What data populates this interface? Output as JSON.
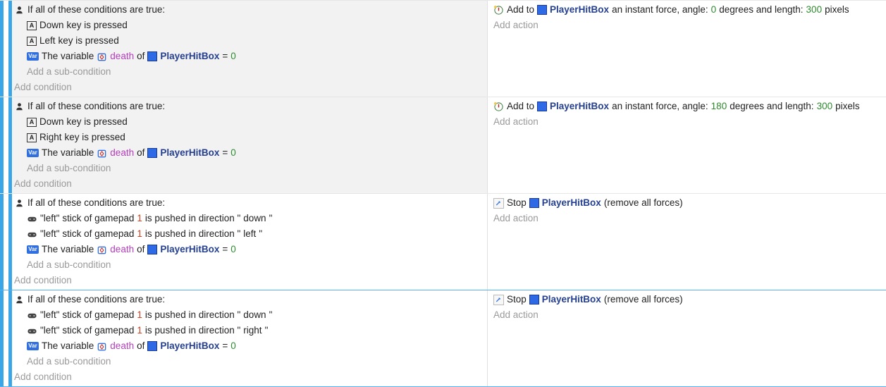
{
  "labels": {
    "if_all_true": "If all of these conditions are true:",
    "add_sub_condition": "Add a sub-condition",
    "add_condition": "Add condition",
    "add_action": "Add action",
    "key_is_pressed": " key is pressed",
    "the_variable": "The variable ",
    "of": " of ",
    "eq": " = ",
    "add_to": "Add to ",
    "force_prefix": " an instant force, angle: ",
    "degrees_and_length": " degrees and length: ",
    "pixels": " pixels",
    "stop": "Stop ",
    "remove_forces": " (remove all forces)",
    "gp_pre": "\"left\" stick of gamepad ",
    "gp_mid": " is pushed in direction \"",
    "gp_suf": "\""
  },
  "object": {
    "name": "PlayerHitBox"
  },
  "variable": {
    "name": "death",
    "value": "0"
  },
  "events": [
    {
      "highlighted": true,
      "lastsel": false,
      "markers": [
        "blue",
        "blank",
        "blue"
      ],
      "conditions": [
        {
          "type": "key",
          "key": "Down"
        },
        {
          "type": "key",
          "key": "Left"
        },
        {
          "type": "var"
        }
      ],
      "actions": [
        {
          "type": "force",
          "angle": "0",
          "length": "300"
        }
      ]
    },
    {
      "highlighted": true,
      "lastsel": false,
      "markers": [
        "blue",
        "blank",
        "blue"
      ],
      "conditions": [
        {
          "type": "key",
          "key": "Down"
        },
        {
          "type": "key",
          "key": "Right"
        },
        {
          "type": "var"
        }
      ],
      "actions": [
        {
          "type": "force",
          "angle": "180",
          "length": "300"
        }
      ]
    },
    {
      "highlighted": false,
      "lastsel": false,
      "markers": [
        "blue",
        "blank",
        "blue"
      ],
      "conditions": [
        {
          "type": "gamepad",
          "dir": "down"
        },
        {
          "type": "gamepad",
          "dir": "left"
        },
        {
          "type": "var"
        }
      ],
      "actions": [
        {
          "type": "stop"
        }
      ]
    },
    {
      "highlighted": false,
      "lastsel": true,
      "markers": [
        "blue",
        "blank",
        "blue"
      ],
      "conditions": [
        {
          "type": "gamepad",
          "dir": "down"
        },
        {
          "type": "gamepad",
          "dir": "right"
        },
        {
          "type": "var"
        }
      ],
      "actions": [
        {
          "type": "stop"
        }
      ]
    }
  ]
}
